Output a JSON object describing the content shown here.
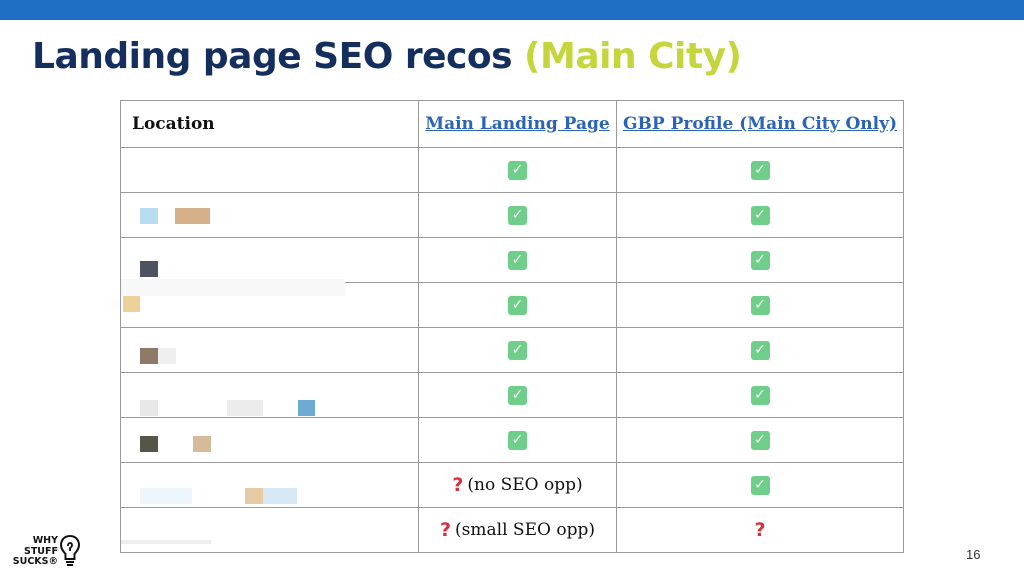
{
  "slide": {
    "title_main": "Landing page SEO recos ",
    "title_accent": "(Main City)",
    "page_number": "16",
    "colors": {
      "top_bar": "#1f6fc6",
      "title": "#142f5e",
      "accent": "#c5d63d",
      "link": "#2a63b8"
    }
  },
  "table": {
    "headers": {
      "location": "Location",
      "main_landing_page": "Main Landing Page",
      "gbp_profile": "GBP Profile (Main City Only)"
    },
    "rows": [
      {
        "main": "check",
        "main_note": "",
        "gbp": "check"
      },
      {
        "main": "check",
        "main_note": "",
        "gbp": "check"
      },
      {
        "main": "check",
        "main_note": "",
        "gbp": "check"
      },
      {
        "main": "check",
        "main_note": "",
        "gbp": "check"
      },
      {
        "main": "check",
        "main_note": "",
        "gbp": "check"
      },
      {
        "main": "check",
        "main_note": "",
        "gbp": "check"
      },
      {
        "main": "check",
        "main_note": "",
        "gbp": "check"
      },
      {
        "main": "question",
        "main_note": "(no SEO opp)",
        "gbp": "check"
      },
      {
        "main": "question",
        "main_note": "(small SEO opp)",
        "gbp": "question"
      }
    ]
  },
  "icons": {
    "check": "✓",
    "question": "?"
  },
  "logo": {
    "line1": "WHY",
    "line2": "STUFF",
    "line3": "SUCKS®"
  }
}
